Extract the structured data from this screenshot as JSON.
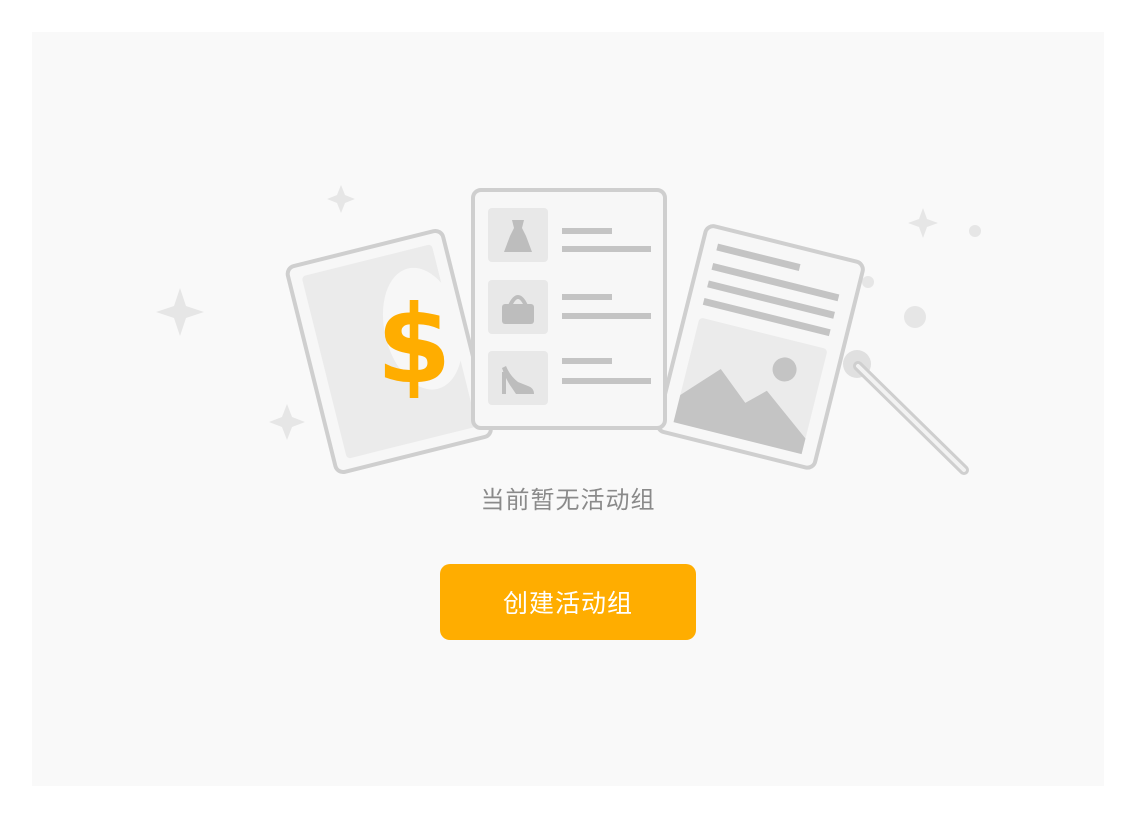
{
  "empty_state": {
    "message": "当前暂无活动组",
    "create_button_label": "创建活动组"
  },
  "colors": {
    "accent": "#ffad00",
    "panel_bg": "#f9f9f9",
    "illustration_gray": "#c9c9c9",
    "illustration_light": "#e8e8e8"
  },
  "icons": [
    "sparkle-icon",
    "coupon-card-icon",
    "dollar-icon",
    "dress-icon",
    "handbag-icon",
    "high-heel-icon",
    "image-card-icon",
    "magic-wand-icon"
  ]
}
